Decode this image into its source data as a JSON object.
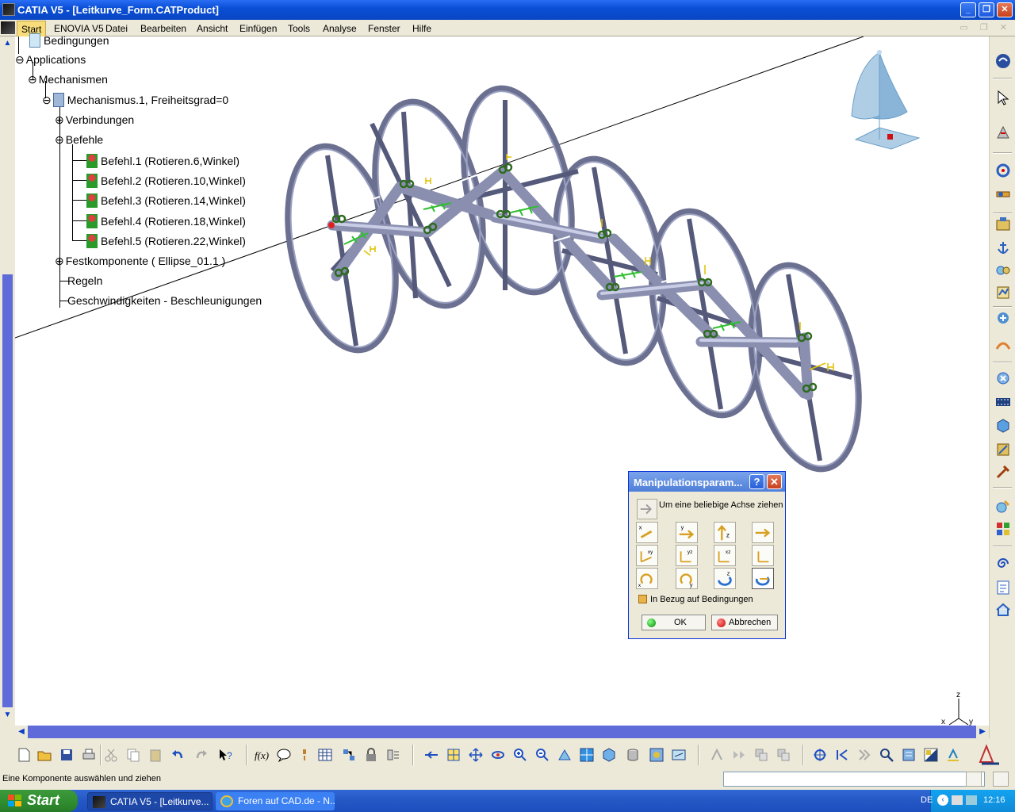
{
  "window": {
    "title": "CATIA V5 - [Leitkurve_Form.CATProduct]",
    "buttons": [
      "minimize-icon",
      "restore-icon",
      "close-icon"
    ]
  },
  "menu": {
    "items": [
      "Start",
      "ENOVIA V5",
      "Datei",
      "Bearbeiten",
      "Ansicht",
      "Einfügen",
      "Tools",
      "Analyse",
      "Fenster",
      "Hilfe"
    ]
  },
  "tree": {
    "bedingungen": "Bedingungen",
    "applications": "Applications",
    "mechanismen": "Mechanismen",
    "mechanismus": "Mechanismus.1, Freiheitsgrad=0",
    "verbindungen": "Verbindungen",
    "befehle": "Befehle",
    "befehl": [
      "Befehl.1 (Rotieren.6,Winkel)",
      "Befehl.2 (Rotieren.10,Winkel)",
      "Befehl.3 (Rotieren.14,Winkel)",
      "Befehl.4 (Rotieren.18,Winkel)",
      "Befehl.5 (Rotieren.22,Winkel)"
    ],
    "festkomponente": "Festkomponente ( Ellipse_01.1 )",
    "regeln": "Regeln",
    "geschwindigkeiten": "Geschwindigkeiten - Beschleunigungen"
  },
  "compass_axes": {
    "x": "x",
    "y": "y",
    "z": "z"
  },
  "dialog": {
    "title": "Manipulationsparam...",
    "help": "?",
    "hint": "Um eine beliebige Achse ziehen",
    "checkbox_label": "In Bezug auf Bedingungen",
    "ok": "OK",
    "cancel": "Abbrechen"
  },
  "status": {
    "message": "Eine Komponente auswählen und ziehen"
  },
  "taskbar": {
    "start": "Start",
    "tasks": [
      "CATIA V5 - [Leitkurve...",
      "Foren auf CAD.de - N..."
    ],
    "lang": "DE",
    "clock": "12:16"
  },
  "colors": {
    "accent": "#0a4fd6",
    "wheel": "#6c7090",
    "link": "#b8bdd8",
    "joint": "#2d6b1f",
    "track": "#5f6bd8"
  }
}
